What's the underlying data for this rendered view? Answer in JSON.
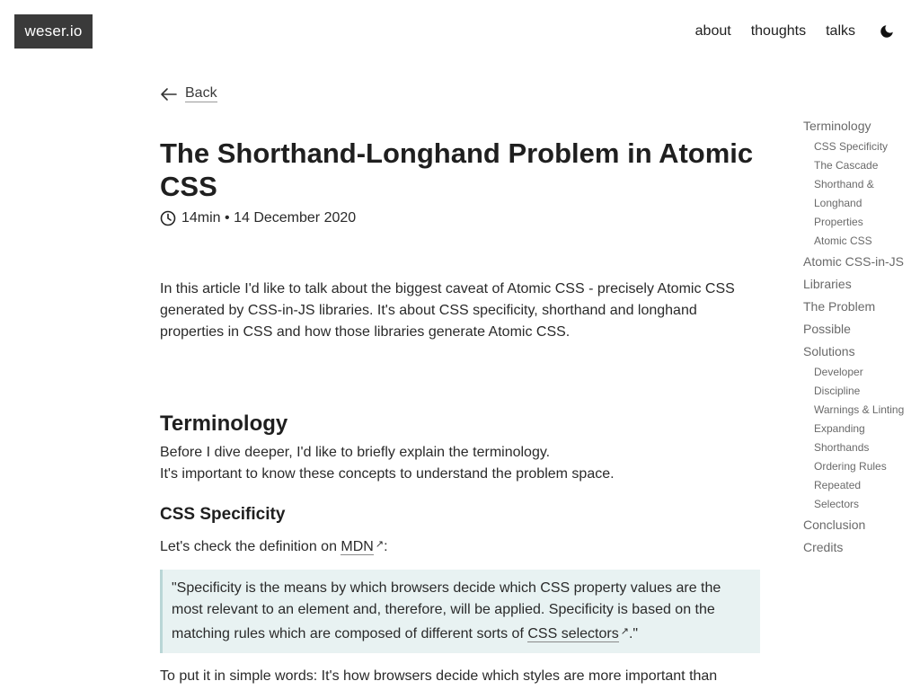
{
  "site": {
    "logo": "weser.io"
  },
  "nav": {
    "items": [
      "about",
      "thoughts",
      "talks"
    ]
  },
  "article": {
    "back_label": "Back",
    "title": "The Shorthand-Longhand Problem in Atomic CSS",
    "meta": "14min • 14 December 2020",
    "intro": "In this article I'd like to talk about the biggest caveat of Atomic CSS - precisely Atomic CSS generated by CSS-in-JS libraries. It's about CSS specificity, shorthand and longhand properties in CSS and how those libraries generate Atomic CSS.",
    "h2_terminology": "Terminology",
    "terminology_p1": "Before I dive deeper, I'd like to briefly explain the terminology.",
    "terminology_p2": "It's important to know these concepts to understand the problem space.",
    "h3_specificity": "CSS Specificity",
    "mdn_prefix": "Let's check the definition on ",
    "mdn_link": "MDN",
    "mdn_suffix": ":",
    "quote_text": "\"Specificity is the means by which browsers decide which CSS property values are the most relevant to an element and, therefore, will be applied. Specificity is based on the matching rules which are composed of different sorts of ",
    "quote_link": "CSS selectors",
    "quote_end": ".\"",
    "last_para": "To put it in simple words: It's how browsers decide which styles are more important than"
  },
  "toc": {
    "terminology": "Terminology",
    "terminology_sub": [
      "CSS Specificity",
      "The Cascade",
      "Shorthand &",
      "Longhand",
      "Properties",
      "Atomic CSS"
    ],
    "atomic_libs": "Atomic CSS-in-JS",
    "libraries": "Libraries",
    "problem": "The Problem",
    "possible": "Possible",
    "solutions": "Solutions",
    "solutions_sub": [
      "Developer",
      "Discipline",
      "Warnings & Linting",
      "Expanding",
      "Shorthands",
      "Ordering Rules",
      "Repeated",
      "Selectors"
    ],
    "conclusion": "Conclusion",
    "credits": "Credits"
  },
  "icons": {
    "theme": "moon-icon",
    "back": "arrow-left-icon",
    "clock": "clock-icon",
    "external": "external-link-icon"
  },
  "colors": {
    "logo_bg": "#3a3a3a",
    "quote_bg": "#e8f2f2",
    "quote_border": "#b9d6d6",
    "toc_text": "#6a6a6a"
  }
}
